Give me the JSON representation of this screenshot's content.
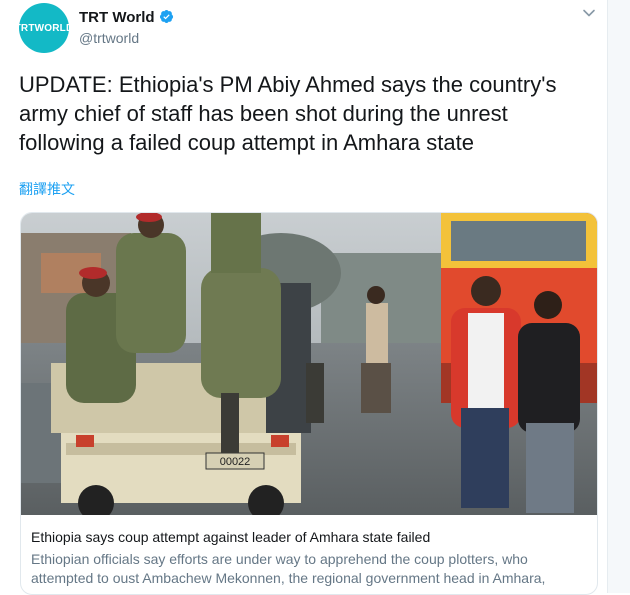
{
  "author": {
    "avatar_text": "TRTWORLD",
    "name": "TRT World",
    "handle": "@trtworld",
    "verified": true
  },
  "tweet": {
    "text": "UPDATE: Ethiopia's PM Abiy Ahmed says the country's army chief of staff has been shot during the unrest following a failed coup attempt in Amhara state",
    "translate_link": "翻譯推文"
  },
  "card": {
    "title": "Ethiopia says coup attempt against leader of Amhara state failed",
    "description": "Ethiopian officials say efforts are under way to apprehend the coup plotters, who attempted to oust Ambachew Mekonnen, the regional government head in Amhara,",
    "image_vehicle_plate": "00022"
  },
  "icons": {
    "verified": "verified-badge-icon",
    "menu": "chevron-down-icon"
  },
  "colors": {
    "brand_teal": "#13b9c6",
    "link_blue": "#1da1f2",
    "muted_gray": "#657786"
  }
}
